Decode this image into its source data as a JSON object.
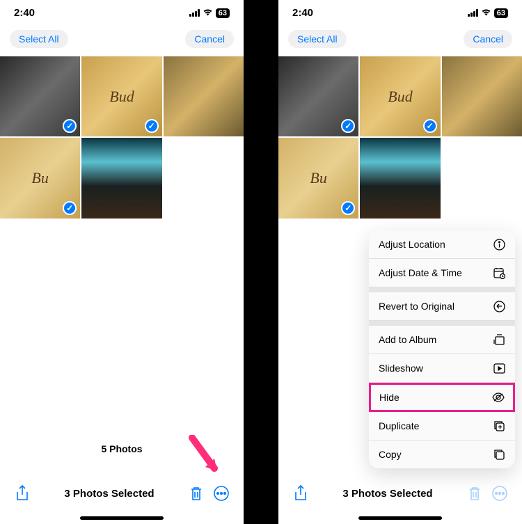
{
  "statusBar": {
    "time": "2:40",
    "battery": "63"
  },
  "topbar": {
    "selectAll": "Select All",
    "cancel": "Cancel"
  },
  "left": {
    "photoCount": "5 Photos",
    "selectedText": "3 Photos Selected"
  },
  "right": {
    "selectedText": "3 Photos Selected"
  },
  "menu": {
    "items": [
      {
        "label": "Adjust Location",
        "icon": "info"
      },
      {
        "label": "Adjust Date & Time",
        "icon": "calendar"
      },
      {
        "label": "Revert to Original",
        "icon": "revert"
      },
      {
        "label": "Add to Album",
        "icon": "album"
      },
      {
        "label": "Slideshow",
        "icon": "play"
      },
      {
        "label": "Hide",
        "icon": "eye-off",
        "highlighted": true
      },
      {
        "label": "Duplicate",
        "icon": "duplicate"
      },
      {
        "label": "Copy",
        "icon": "copy"
      }
    ]
  }
}
